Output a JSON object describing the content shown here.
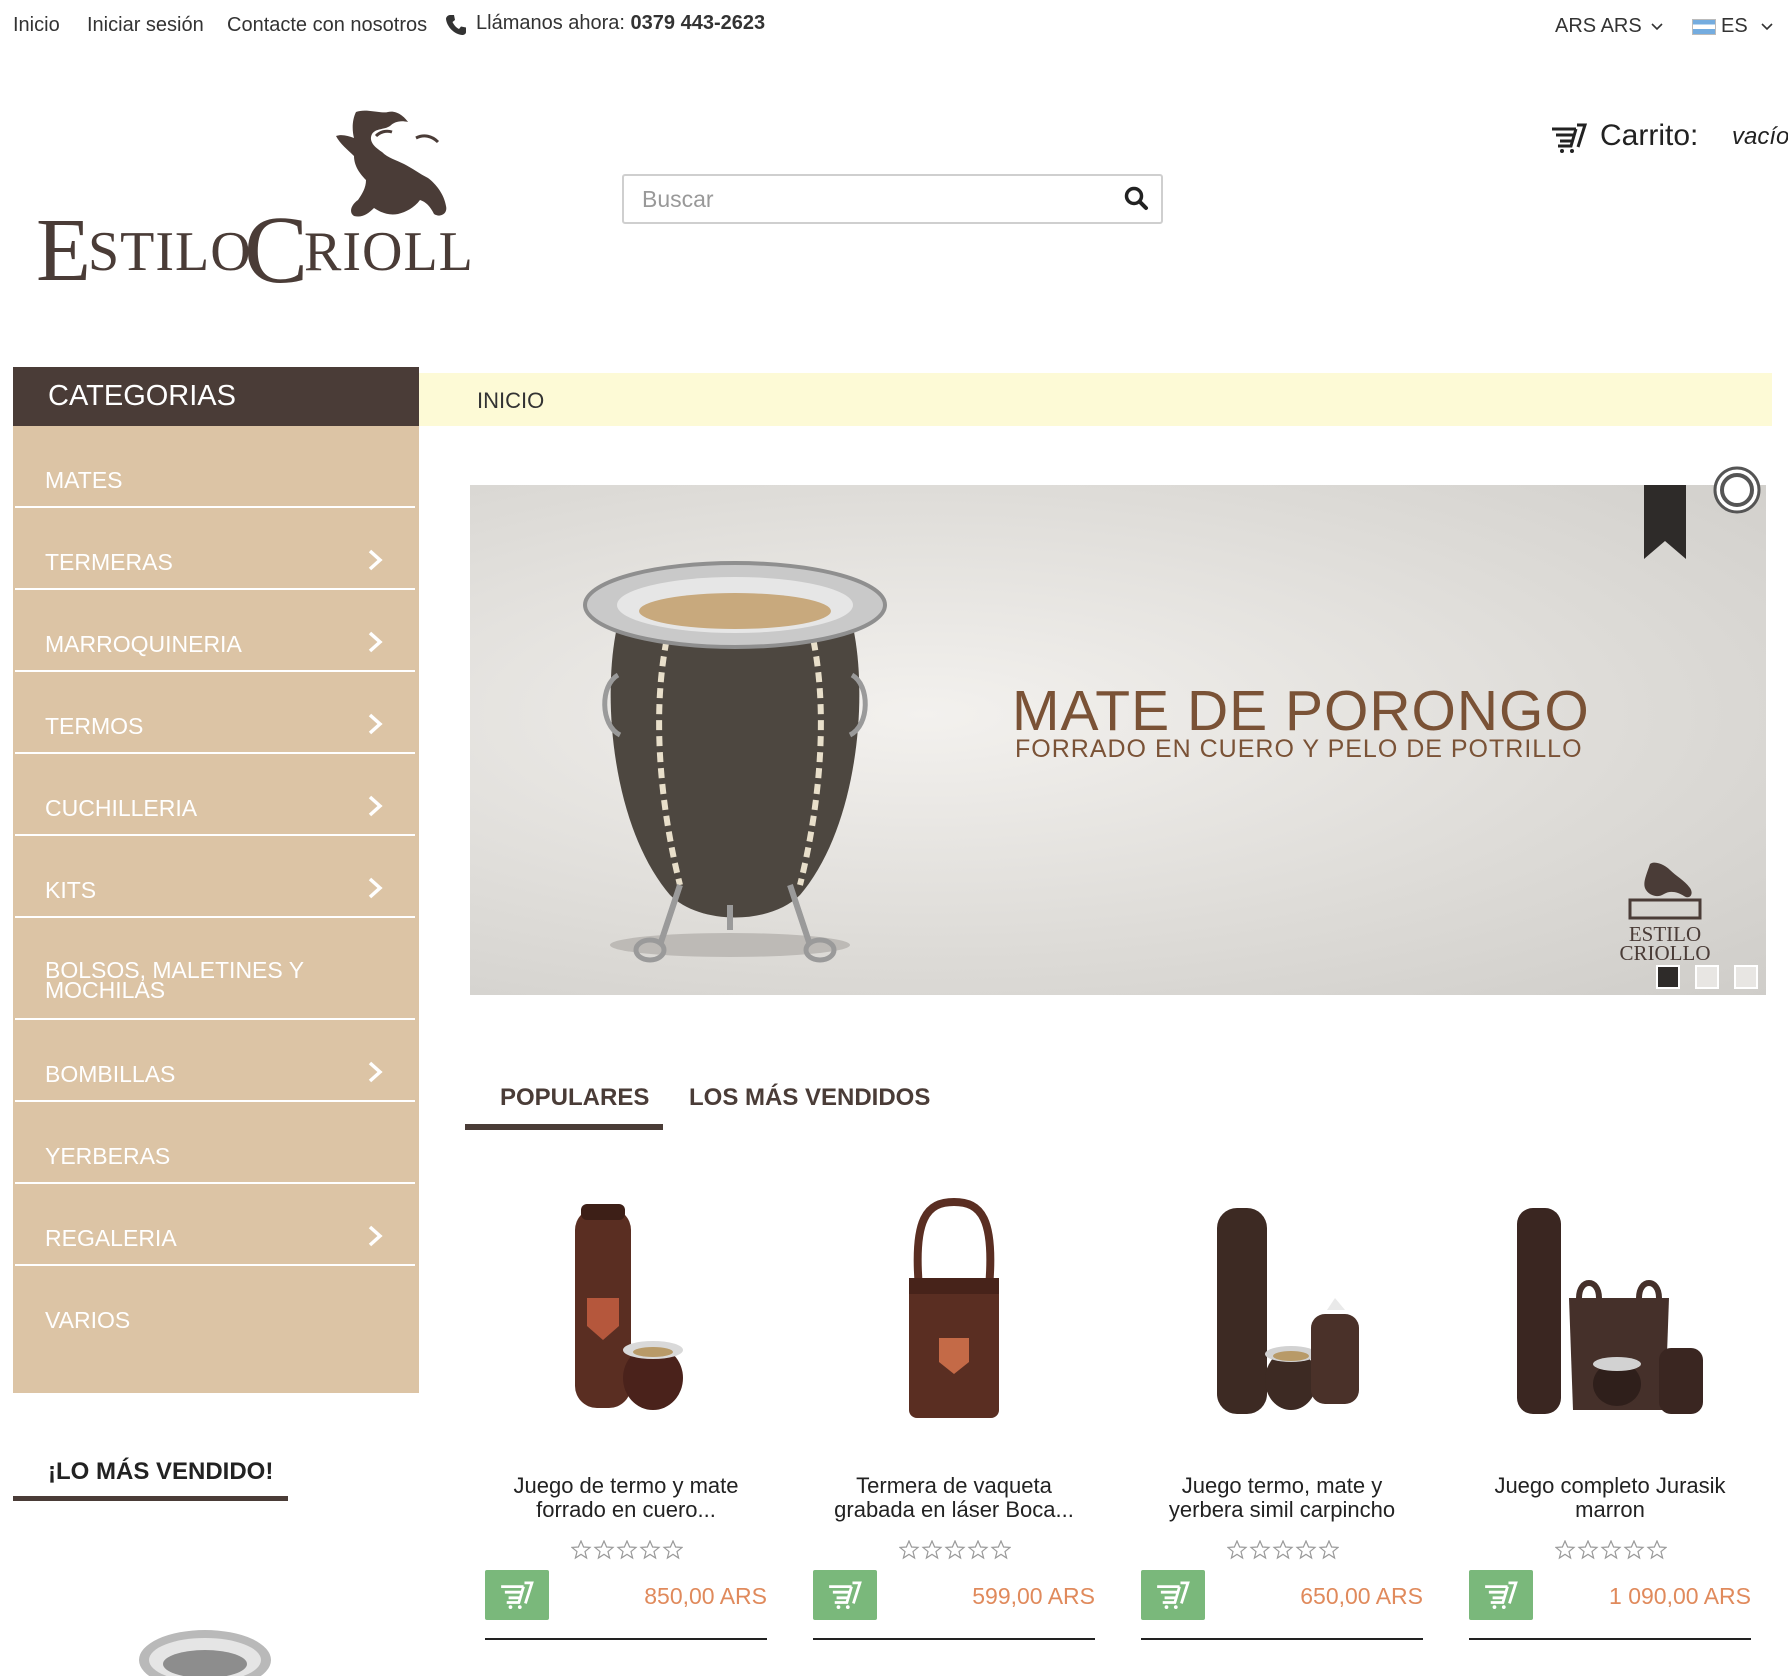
{
  "topbar": {
    "home": "Inicio",
    "login": "Iniciar sesión",
    "contact": "Contacte con nosotros",
    "call_label": "Llámanos ahora:",
    "phone": "0379 443-2623",
    "currency": "ARS ARS",
    "language": "ES"
  },
  "header": {
    "logo_text": "EstiloCriollo",
    "search_placeholder": "Buscar",
    "cart_label": "Carrito:",
    "cart_state": "vacío"
  },
  "sidebar": {
    "title": "CATEGORIAS",
    "items": [
      {
        "label": "MATES",
        "has_children": false
      },
      {
        "label": "TERMERAS",
        "has_children": true
      },
      {
        "label": "MARROQUINERIA",
        "has_children": true
      },
      {
        "label": "TERMOS",
        "has_children": true
      },
      {
        "label": "CUCHILLERIA",
        "has_children": true
      },
      {
        "label": "KITS",
        "has_children": true
      },
      {
        "label": "BOLSOS, MALETINES Y MOCHILAS",
        "has_children": false
      },
      {
        "label": "BOMBILLAS",
        "has_children": true
      },
      {
        "label": "YERBERAS",
        "has_children": false
      },
      {
        "label": "REGALERIA",
        "has_children": true
      },
      {
        "label": "VARIOS",
        "has_children": false
      }
    ],
    "bestsellers_title": "¡LO MÁS VENDIDO!"
  },
  "breadcrumb": {
    "current": "INICIO"
  },
  "slider": {
    "title": "MATE DE PORONGO",
    "subtitle": "FORRADO EN CUERO Y PELO DE POTRILLO",
    "brand_line1": "ESTILO",
    "brand_line2": "CRIOLLO",
    "slides": 3,
    "active_slide": 1
  },
  "tabs": [
    "POPULARES",
    "LOS MÁS VENDIDOS"
  ],
  "products": [
    {
      "name_line1": "Juego de termo y mate",
      "name_line2": "forrado en cuero...",
      "price": "850,00 ARS",
      "rating": 0
    },
    {
      "name_line1": "Termera de vaqueta",
      "name_line2": "grabada en láser Boca...",
      "price": "599,00 ARS",
      "rating": 0
    },
    {
      "name_line1": "Juego termo, mate y",
      "name_line2": "yerbera simil carpincho",
      "price": "650,00 ARS",
      "rating": 0
    },
    {
      "name_line1": "Juego completo Jurasik",
      "name_line2": "marron",
      "price": "1 090,00 ARS",
      "rating": 0
    }
  ],
  "colors": {
    "brand_dark": "#4a3c37",
    "sidebar_bg": "#dcc4a5",
    "breadcrumb_bg": "#fdfad6",
    "add_to_cart": "#7ab87b",
    "price": "#e08a5c",
    "slider_text": "#7a5236"
  },
  "icons": {
    "phone": "phone-icon",
    "search": "search-icon",
    "cart": "cart-icon",
    "chevron": "chevron-right-icon",
    "star": "star-outline-icon"
  }
}
